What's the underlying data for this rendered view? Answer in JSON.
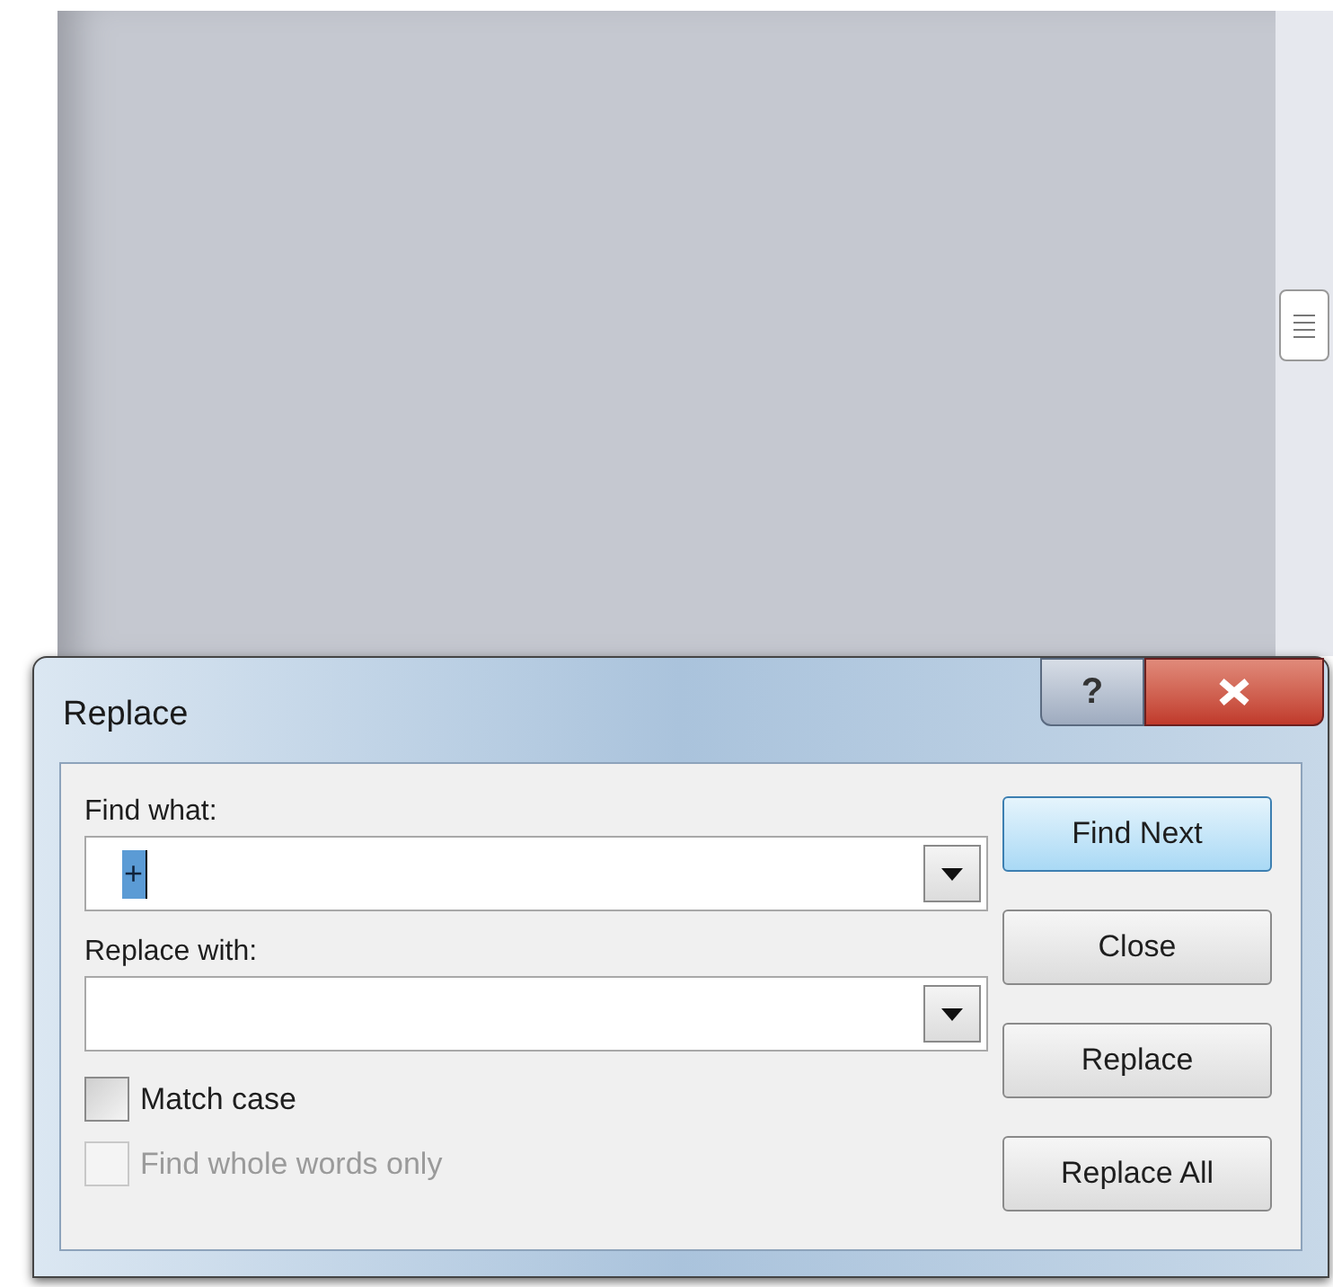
{
  "dialog": {
    "title": "Replace",
    "title_buttons": [
      {
        "kind": "help",
        "label": "?"
      },
      {
        "kind": "close"
      }
    ],
    "fields": [
      {
        "label": "Find what:",
        "value": "+",
        "text_selected": true
      },
      {
        "label": "Replace with:"
      }
    ],
    "options": [
      {
        "label": "Match case",
        "checked": false,
        "disabled": false
      },
      {
        "label": "Find whole words only",
        "checked": false,
        "disabled": true
      }
    ],
    "buttons": [
      {
        "label": "Find Next",
        "default": true
      },
      {
        "label": "Close",
        "default": false
      },
      {
        "label": "Replace",
        "default": false
      },
      {
        "label": "Replace All",
        "default": false
      }
    ]
  }
}
